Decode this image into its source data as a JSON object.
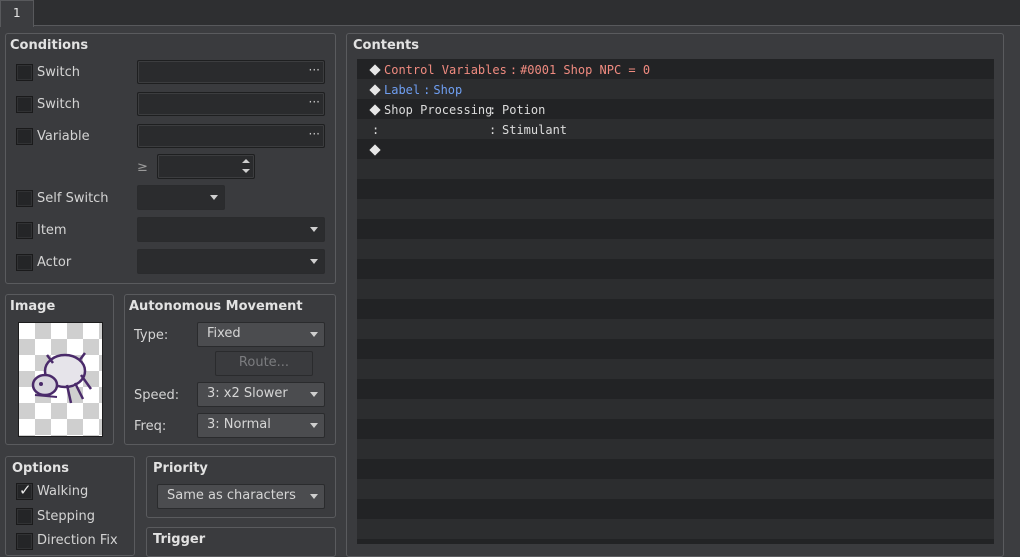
{
  "tabs": [
    "1"
  ],
  "conditions": {
    "title": "Conditions",
    "switch1": {
      "label": "Switch",
      "checked": false,
      "value": ""
    },
    "switch2": {
      "label": "Switch",
      "checked": false,
      "value": ""
    },
    "variable": {
      "label": "Variable",
      "checked": false,
      "value": "",
      "operator": "≥",
      "compare_value": ""
    },
    "self_switch": {
      "label": "Self Switch",
      "checked": false,
      "value": ""
    },
    "item": {
      "label": "Item",
      "checked": false,
      "value": ""
    },
    "actor": {
      "label": "Actor",
      "checked": false,
      "value": ""
    }
  },
  "image": {
    "title": "Image"
  },
  "autonomous_movement": {
    "title": "Autonomous Movement",
    "type_label": "Type:",
    "type_value": "Fixed",
    "route_label": "Route...",
    "speed_label": "Speed:",
    "speed_value": "3: x2 Slower",
    "freq_label": "Freq:",
    "freq_value": "3: Normal"
  },
  "options": {
    "title": "Options",
    "walking": {
      "label": "Walking",
      "checked": true
    },
    "stepping": {
      "label": "Stepping",
      "checked": false
    },
    "direction_fix": {
      "label": "Direction Fix",
      "checked": false
    }
  },
  "priority": {
    "title": "Priority",
    "value": "Same as characters"
  },
  "trigger": {
    "title": "Trigger"
  },
  "contents": {
    "title": "Contents",
    "rows": [
      {
        "command": "Control Variables",
        "params": "#0001 Shop NPC = 0",
        "color": "#f08b80"
      },
      {
        "command": "Label",
        "params": "Shop",
        "color": "#6f9ff2"
      },
      {
        "command": "Shop Processing",
        "params": "Potion",
        "color": "#dcdcdc"
      },
      {
        "command": "",
        "params": "Stimulant",
        "color": "#dcdcdc"
      }
    ],
    "separator": ":"
  },
  "colors": {
    "background": "#3c3d40",
    "list_even": "#222325",
    "list_odd": "#2c2d2f"
  }
}
